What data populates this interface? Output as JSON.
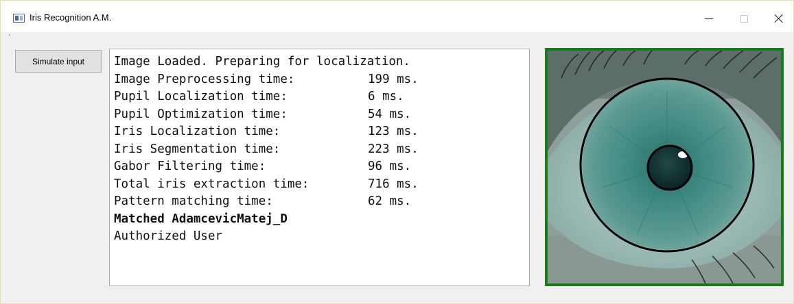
{
  "window": {
    "title": "Iris Recognition A.M."
  },
  "toolbar": {
    "simulate_label": "Simulate input"
  },
  "log": {
    "header": "Image Loaded. Preparing for localization.",
    "timings": [
      {
        "label": "Image Preprocessing time:",
        "value": "199 ms."
      },
      {
        "label": "Pupil Localization time:",
        "value": "6 ms."
      },
      {
        "label": "Pupil Optimization time:",
        "value": "54 ms."
      },
      {
        "label": "Iris Localization time:",
        "value": "123 ms."
      },
      {
        "label": "Iris Segmentation time:",
        "value": "223 ms."
      },
      {
        "label": "Gabor Filtering time:",
        "value": "96 ms."
      },
      {
        "label": "Total iris extraction time:",
        "value": "716 ms."
      },
      {
        "label": "Pattern matching time:",
        "value": "62 ms."
      }
    ],
    "match_result": "Matched AdamcevicMatej_D",
    "auth_status": "Authorized User"
  },
  "eye_image": {
    "frame_color": "#1a7a1a",
    "iris_color": "#3f8a82",
    "circle_color": "#000000"
  }
}
